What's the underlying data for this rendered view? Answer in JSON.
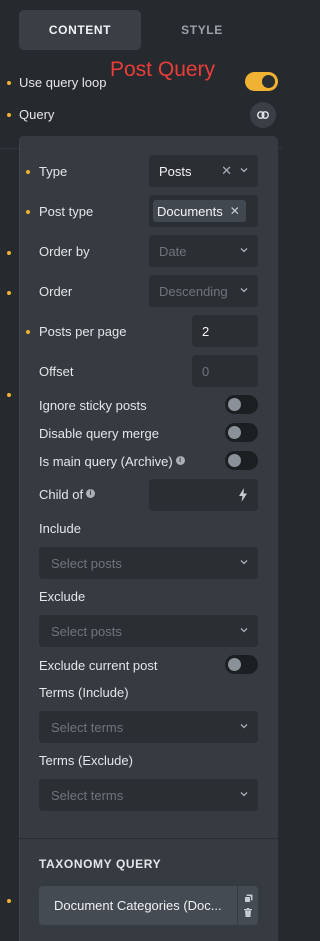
{
  "tabs": {
    "content": "CONTENT",
    "style": "STYLE"
  },
  "annotation": "Post Query",
  "outer": {
    "use_query_loop": {
      "label": "Use query loop",
      "enabled": true
    },
    "query": {
      "label": "Query"
    }
  },
  "query": {
    "type": {
      "label": "Type",
      "value": "Posts"
    },
    "post_type": {
      "label": "Post type",
      "chip": "Documents"
    },
    "order_by": {
      "label": "Order by",
      "placeholder": "Date"
    },
    "order": {
      "label": "Order",
      "placeholder": "Descending"
    },
    "posts_per_page": {
      "label": "Posts per page",
      "value": "2"
    },
    "offset": {
      "label": "Offset",
      "placeholder": "0"
    },
    "ignore_sticky": {
      "label": "Ignore sticky posts",
      "enabled": false
    },
    "disable_merge": {
      "label": "Disable query merge",
      "enabled": false
    },
    "is_main_query": {
      "label": "Is main query (Archive)",
      "enabled": false
    },
    "child_of": {
      "label": "Child of"
    },
    "include": {
      "label": "Include",
      "placeholder": "Select posts"
    },
    "exclude": {
      "label": "Exclude",
      "placeholder": "Select posts"
    },
    "exclude_current": {
      "label": "Exclude current post",
      "enabled": false
    },
    "terms_include": {
      "label": "Terms (Include)",
      "placeholder": "Select terms"
    },
    "terms_exclude": {
      "label": "Terms (Exclude)",
      "placeholder": "Select terms"
    }
  },
  "taxonomy": {
    "title": "TAXONOMY QUERY",
    "items": [
      {
        "label": "Document Categories (Doc..."
      }
    ]
  },
  "colors": {
    "accent": "#f0b232",
    "annotation": "#ea3d3a",
    "panel": "#363b41",
    "background": "#262a2f"
  }
}
